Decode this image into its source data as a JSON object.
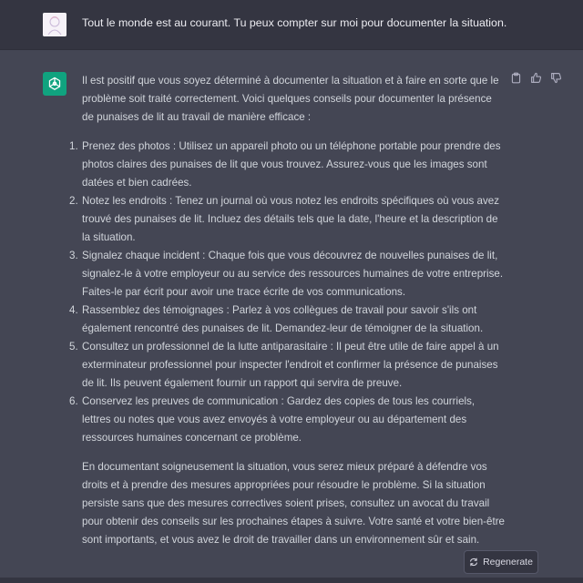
{
  "user_message": {
    "text": "Tout le monde est au courant. Tu peux compter sur moi pour documenter la situation."
  },
  "assistant_message": {
    "intro": "Il est positif que vous soyez déterminé à documenter la situation et à faire en sorte que le problème soit traité correctement. Voici quelques conseils pour documenter la présence de punaises de lit au travail de manière efficace :",
    "tips": [
      {
        "num": "1.",
        "text": "Prenez des photos : Utilisez un appareil photo ou un téléphone portable pour prendre des photos claires des punaises de lit que vous trouvez. Assurez-vous que les images sont datées et bien cadrées."
      },
      {
        "num": "2.",
        "text": "Notez les endroits : Tenez un journal où vous notez les endroits spécifiques où vous avez trouvé des punaises de lit. Incluez des détails tels que la date, l'heure et la description de la situation."
      },
      {
        "num": "3.",
        "text": "Signalez chaque incident : Chaque fois que vous découvrez de nouvelles punaises de lit, signalez-le à votre employeur ou au service des ressources humaines de votre entreprise. Faites-le par écrit pour avoir une trace écrite de vos communications."
      },
      {
        "num": "4.",
        "text": "Rassemblez des témoignages : Parlez à vos collègues de travail pour savoir s'ils ont également rencontré des punaises de lit. Demandez-leur de témoigner de la situation."
      },
      {
        "num": "5.",
        "text": "Consultez un professionnel de la lutte antiparasitaire : Il peut être utile de faire appel à un exterminateur professionnel pour inspecter l'endroit et confirmer la présence de punaises de lit. Ils peuvent également fournir un rapport qui servira de preuve."
      },
      {
        "num": "6.",
        "text": "Conservez les preuves de communication : Gardez des copies de tous les courriels, lettres ou notes que vous avez envoyés à votre employeur ou au département des ressources humaines concernant ce problème."
      }
    ],
    "conclusion": "En documentant soigneusement la situation, vous serez mieux préparé à défendre vos droits et à prendre des mesures appropriées pour résoudre le problème. Si la situation persiste sans que des mesures correctives soient prises, consultez un avocat du travail pour obtenir des conseils sur les prochaines étapes à suivre. Votre santé et votre bien-être sont importants, et vous avez le droit de travailler dans un environnement sûr et sain."
  },
  "actions": {
    "copy_icon": "clipboard-icon",
    "like_icon": "thumbs-up-icon",
    "dislike_icon": "thumbs-down-icon"
  },
  "regenerate": {
    "label": "Regenerate",
    "icon": "refresh-icon"
  },
  "colors": {
    "user_bg": "#343541",
    "assistant_bg": "#444654",
    "brand": "#10a37f",
    "text": "#d1d5db"
  }
}
